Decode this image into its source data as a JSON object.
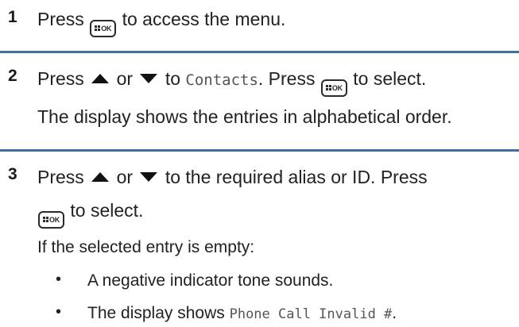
{
  "steps": [
    {
      "number": "1",
      "press": "Press",
      "text_after_button": "to access the menu."
    },
    {
      "number": "2",
      "press": "Press",
      "or": "or",
      "to": "to",
      "target_mono": "Contacts",
      "after_target": ". Press",
      "text_after_button": "to select.",
      "note": "The display shows the entries in alphabetical order."
    },
    {
      "number": "3",
      "press": "Press",
      "or": "or",
      "text_after_arrows": "to the required alias or ID. Press",
      "text_after_button": "to select.",
      "condition": "If the selected entry is empty:",
      "bullets": [
        {
          "symbol": "•",
          "text": "A negative indicator tone sounds."
        },
        {
          "symbol": "•",
          "text_before_mono": "The display shows",
          "mono": "Phone Call Invalid #",
          "after": "."
        }
      ]
    }
  ],
  "button_label": "OK",
  "icons": {
    "menu_ok": "menu-ok-button-icon",
    "up": "up-arrow-icon",
    "down": "down-arrow-icon"
  },
  "colors": {
    "divider": "#3f6f9f"
  }
}
